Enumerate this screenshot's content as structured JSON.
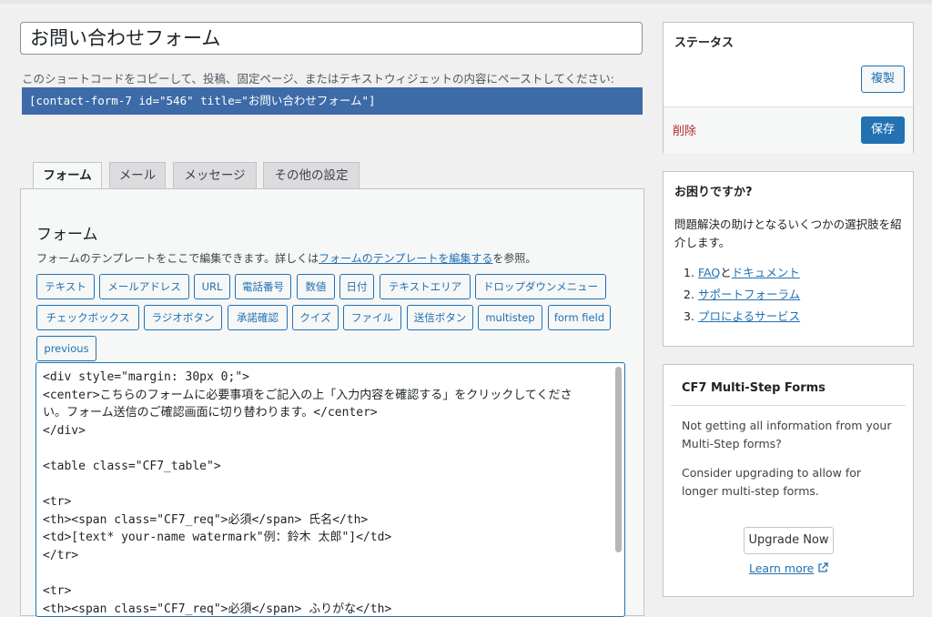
{
  "form_title": "お問い合わせフォーム",
  "shortcode_desc": "このショートコードをコピーして、投稿、固定ページ、またはテキストウィジェットの内容にペーストしてください:",
  "shortcode": "[contact-form-7 id=\"546\" title=\"お問い合わせフォーム\"]",
  "tabs": [
    {
      "label": "フォーム",
      "active": true
    },
    {
      "label": "メール",
      "active": false
    },
    {
      "label": "メッセージ",
      "active": false
    },
    {
      "label": "その他の設定",
      "active": false
    }
  ],
  "panel": {
    "title": "フォーム",
    "desc_before": "フォームのテンプレートをここで編集できます。詳しくは",
    "desc_link": "フォームのテンプレートを編集する",
    "desc_after": "を参照。"
  },
  "tag_buttons": [
    "テキスト",
    "メールアドレス",
    "URL",
    "電話番号",
    "数値",
    "日付",
    "テキストエリア",
    "ドロップダウンメニュー",
    "チェックボックス",
    "ラジオボタン",
    "承諾確認",
    "クイズ",
    "ファイル",
    "送信ボタン",
    "multistep",
    "form field",
    "previous"
  ],
  "code_lines": [
    "<div style=\"margin: 30px 0;\">",
    "<center>こちらのフォームに必要事項をご記入の上「入力内容を確認する」をクリックしてくださ",
    "い。フォーム送信のご確認画面に切り替わります。</center>",
    "</div>",
    "",
    "<table class=\"CF7_table\">",
    "",
    "<tr>",
    "<th><span class=\"CF7_req\">必須</span> 氏名</th>",
    "<td>[text* your-name watermark\"例：鈴木 太郎\"]</td>",
    "</tr>",
    "",
    "<tr>",
    "<th><span class=\"CF7_req\">必須</span> ふりがな</th>"
  ],
  "status": {
    "title": "ステータス",
    "duplicate_label": "複製",
    "delete_label": "削除",
    "save_label": "保存"
  },
  "help": {
    "title": "お困りですか?",
    "text": "問題解決の助けとなるいくつかの選択肢を紹介します。",
    "items": [
      {
        "num": "1.",
        "link1": "FAQ",
        "mid": "と",
        "link2": "ドキュメント"
      },
      {
        "num": "2.",
        "link1": "サポートフォーラム",
        "mid": "",
        "link2": ""
      },
      {
        "num": "3.",
        "link1": "プロによるサービス",
        "mid": "",
        "link2": ""
      }
    ]
  },
  "multistep": {
    "title": "CF7 Multi-Step Forms",
    "text1": "Not getting all information from your Multi-Step forms?",
    "text2": "Consider upgrading to allow for longer multi-step forms.",
    "upgrade_label": "Upgrade Now",
    "learn_more": "Learn more"
  }
}
